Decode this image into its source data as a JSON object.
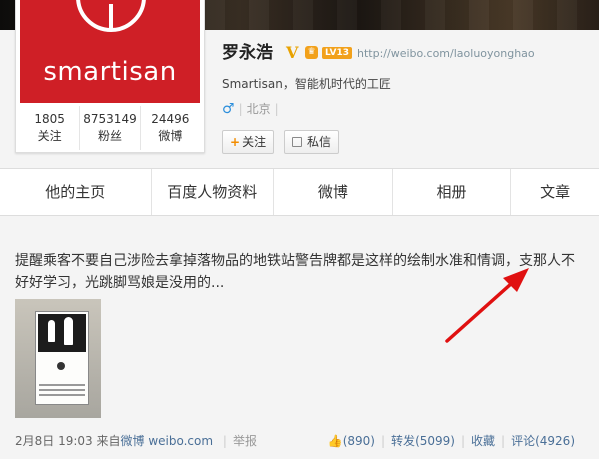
{
  "profile": {
    "logo_text": "smartisan",
    "name": "罗永浩",
    "verified_mark": "V",
    "level_badge": "LV13",
    "url": "http://weibo.com/laoluoyonghao",
    "bio": "Smartisan，智能机时代的工匠",
    "gender_icon": "♂",
    "location": "北京",
    "follow_label": "关注",
    "message_label": "私信",
    "stats": [
      {
        "value": "1805",
        "label": "关注"
      },
      {
        "value": "8753149",
        "label": "粉丝"
      },
      {
        "value": "24496",
        "label": "微博"
      }
    ]
  },
  "tabs": [
    {
      "label": "他的主页"
    },
    {
      "label": "百度人物资料"
    },
    {
      "label": "微博"
    },
    {
      "label": "相册"
    },
    {
      "label": "文章"
    }
  ],
  "post": {
    "text": "提醒乘客不要自己涉险去拿掉落物品的地铁站警告牌都是这样的绘制水准和情调，支那人不好好学习，光跳脚骂娘是没用的...",
    "time": "2月8日 19:03",
    "source_prefix": "来自",
    "source": "微博 weibo.com",
    "report": "举报",
    "like_count": "(890)",
    "repost_label": "转发",
    "repost_count": "(5099)",
    "favorite_label": "收藏",
    "comment_label": "评论",
    "comment_count": "(4926)"
  },
  "colors": {
    "brand_red": "#cf1f26",
    "link_blue": "#4a6f97",
    "annotation_arrow": "#e01010"
  }
}
